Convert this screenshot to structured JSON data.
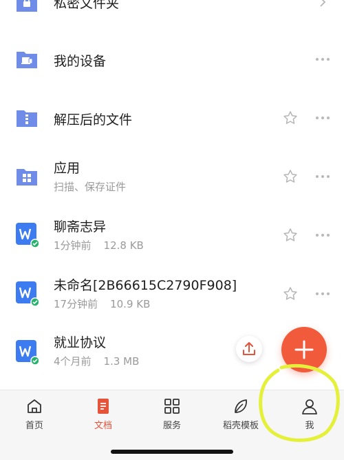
{
  "files": [
    {
      "title": "私密文件夹",
      "subtitle": null,
      "icon": "lock-folder-icon",
      "action": "chevron-right-icon"
    },
    {
      "title": "我的设备",
      "subtitle": null,
      "icon": "device-folder-icon",
      "action": "more-icon"
    },
    {
      "title": "解压后的文件",
      "subtitle": null,
      "icon": "zip-folder-icon",
      "action": "star-more"
    },
    {
      "title": "应用",
      "subtitle": "扫描、保存证件",
      "icon": "apps-folder-icon",
      "action": "star-more"
    },
    {
      "title": "聊斋志异",
      "time": "1分钟前",
      "size": "12.8 KB",
      "icon": "wps-doc-icon",
      "action": "star-more"
    },
    {
      "title": "未命名[2B66615C2790F908]",
      "time": "17分钟前",
      "size": "10.9 KB",
      "icon": "wps-doc-icon",
      "action": "star-more"
    },
    {
      "title": "就业协议",
      "time": "4个月前",
      "size": "1.3 MB",
      "icon": "wps-doc-icon",
      "action": "upload"
    }
  ],
  "tabs": [
    {
      "label": "首页",
      "icon": "home-icon",
      "active": false
    },
    {
      "label": "文档",
      "icon": "document-icon",
      "active": true
    },
    {
      "label": "服务",
      "icon": "grid-icon",
      "active": false
    },
    {
      "label": "稻壳模板",
      "icon": "leaf-icon",
      "active": false
    },
    {
      "label": "我",
      "icon": "person-icon",
      "active": false
    }
  ],
  "colors": {
    "accent": "#e5533b",
    "fab": "#f25a3c",
    "folder": "#6f8de8",
    "wps_blue": "#3d7bf0",
    "sync_badge": "#27b36b",
    "annotation": "#e4f03a"
  }
}
